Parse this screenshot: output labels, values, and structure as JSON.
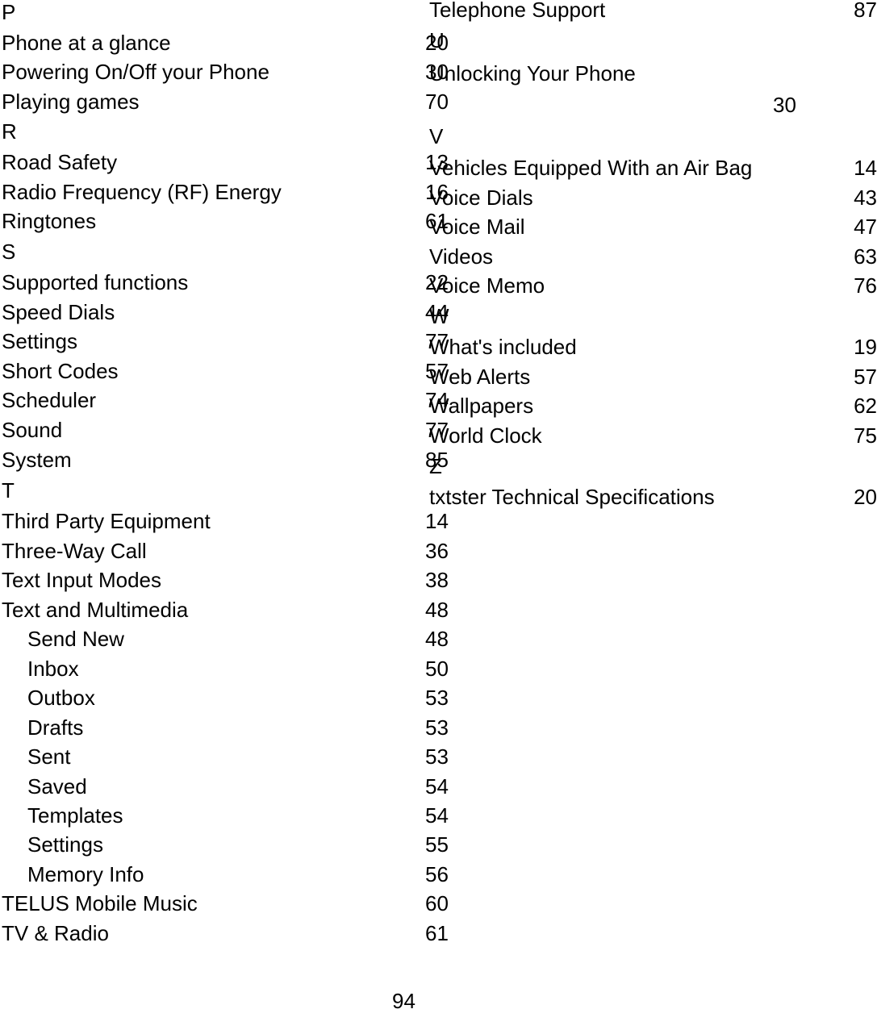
{
  "page_number": "94",
  "left_column": [
    {
      "type": "letter",
      "text": "P"
    },
    {
      "type": "entry",
      "text": "Phone at a glance",
      "page": "20"
    },
    {
      "type": "entry",
      "text": "Powering On/Off your Phone",
      "page": "30"
    },
    {
      "type": "entry",
      "text": "Playing games",
      "page": "70"
    },
    {
      "type": "letter",
      "text": "R"
    },
    {
      "type": "entry",
      "text": "Road Safety",
      "page": "13"
    },
    {
      "type": "entry",
      "text": "Radio Frequency (RF) Energy",
      "page": "16"
    },
    {
      "type": "entry",
      "text": "Ringtones",
      "page": "61"
    },
    {
      "type": "letter",
      "text": "S"
    },
    {
      "type": "entry",
      "text": "Supported functions",
      "page": "22"
    },
    {
      "type": "entry",
      "text": "Speed Dials",
      "page": "44"
    },
    {
      "type": "entry",
      "text": "Settings",
      "page": "77"
    },
    {
      "type": "entry",
      "text": "Short Codes",
      "page": "57"
    },
    {
      "type": "entry",
      "text": "Scheduler",
      "page": "74"
    },
    {
      "type": "entry",
      "text": "Sound",
      "page": "77"
    },
    {
      "type": "entry",
      "text": "System",
      "page": "85"
    },
    {
      "type": "letter",
      "text": "T"
    },
    {
      "type": "entry",
      "text": "Third Party Equipment",
      "page": "14"
    },
    {
      "type": "entry",
      "text": "Three-Way Call",
      "page": "36"
    },
    {
      "type": "entry",
      "text": "Text Input Modes",
      "page": "38"
    },
    {
      "type": "entry",
      "text": "Text and Multimedia",
      "page": "48"
    },
    {
      "type": "sub",
      "text": "Send New",
      "page": "48"
    },
    {
      "type": "sub",
      "text": "Inbox",
      "page": "50"
    },
    {
      "type": "sub",
      "text": "Outbox",
      "page": "53"
    },
    {
      "type": "sub",
      "text": "Drafts",
      "page": "53"
    },
    {
      "type": "sub",
      "text": "Sent",
      "page": "53"
    },
    {
      "type": "sub",
      "text": "Saved",
      "page": "54"
    },
    {
      "type": "sub",
      "text": "Templates",
      "page": "54"
    },
    {
      "type": "sub",
      "text": "Settings",
      "page": "55"
    },
    {
      "type": "sub",
      "text": "Memory Info",
      "page": "56"
    },
    {
      "type": "entry",
      "text": "TELUS Mobile Music",
      "page": "60"
    },
    {
      "type": "entry",
      "text": "TV & Radio",
      "page": "61"
    }
  ],
  "right_column": [
    {
      "type": "entry",
      "text": "Telephone Support",
      "page": "87"
    },
    {
      "type": "letter",
      "text": "U"
    },
    {
      "type": "entry",
      "text": "Unlocking Your Phone",
      "page": "30"
    },
    {
      "type": "letter",
      "text": "V"
    },
    {
      "type": "entry",
      "text": "Vehicles Equipped With an Air Bag",
      "page": "14"
    },
    {
      "type": "entry",
      "text": "Voice Dials",
      "page": "43"
    },
    {
      "type": "entry",
      "text": "Voice Mail",
      "page": "47"
    },
    {
      "type": "entry",
      "text": "Videos",
      "page": "63"
    },
    {
      "type": "entry",
      "text": "Voice Memo",
      "page": "76"
    },
    {
      "type": "letter",
      "text": "W"
    },
    {
      "type": "entry",
      "text": "What's included",
      "page": "19"
    },
    {
      "type": "entry",
      "text": "Web Alerts",
      "page": "57"
    },
    {
      "type": "entry",
      "text": "Wallpapers",
      "page": "62"
    },
    {
      "type": "entry",
      "text": "World Clock",
      "page": "75"
    },
    {
      "type": "letter",
      "text": "Z"
    },
    {
      "type": "entry",
      "text": "txtster Technical Specifications",
      "page": "20"
    }
  ]
}
